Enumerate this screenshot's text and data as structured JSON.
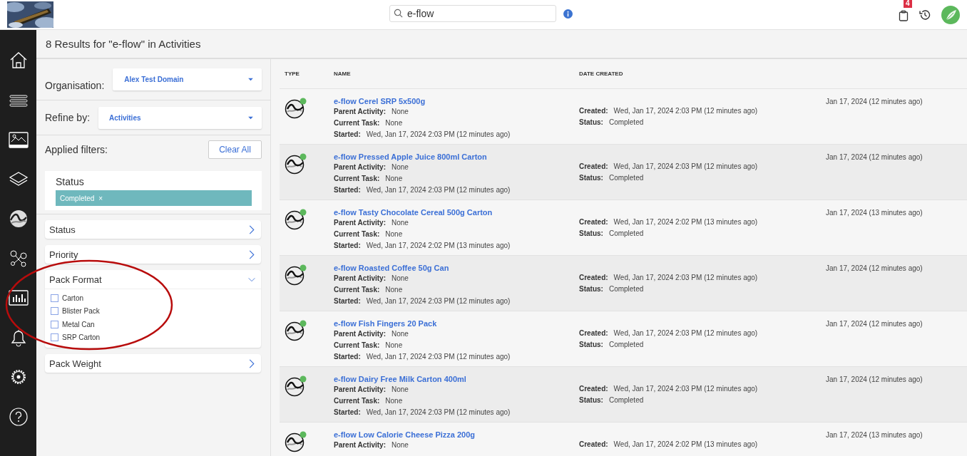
{
  "header": {
    "search": {
      "value": "e-flow"
    },
    "cart_badge": "4"
  },
  "nav": [
    {
      "kind": "home"
    },
    {
      "kind": "list"
    },
    {
      "kind": "gallery"
    },
    {
      "kind": "layers"
    },
    {
      "kind": "eflow"
    },
    {
      "kind": "network"
    },
    {
      "kind": "chart"
    },
    {
      "kind": "bell"
    },
    {
      "kind": "gear"
    },
    {
      "kind": "help"
    }
  ],
  "title": "8 Results for \"e-flow\" in Activities",
  "filters": {
    "organisation": {
      "label": "Organisation:",
      "value": "Alex Test Domain"
    },
    "refine": {
      "label": "Refine by:",
      "value": "Activities"
    },
    "applied": {
      "label": "Applied filters:",
      "clear": "Clear All",
      "groups": [
        {
          "title": "Status",
          "chips": [
            {
              "label": "Completed",
              "remove": "×"
            }
          ]
        }
      ]
    },
    "accordions": [
      {
        "title": "Status",
        "expanded": false
      },
      {
        "title": "Priority",
        "expanded": false
      },
      {
        "title": "Pack Format",
        "expanded": true,
        "options": [
          {
            "label": "Carton",
            "checked": false
          },
          {
            "label": "Blister Pack",
            "checked": false
          },
          {
            "label": "Metal Can",
            "checked": false
          },
          {
            "label": "SRP Carton",
            "checked": false
          }
        ]
      },
      {
        "title": "Pack Weight",
        "expanded": false
      }
    ]
  },
  "table": {
    "columns": [
      "TYPE",
      "NAME",
      "DATE CREATED"
    ],
    "rows": [
      {
        "name": "e-flow Cerel SRP 5x500g",
        "left": [
          {
            "label": "Parent Activity:",
            "value": "None"
          },
          {
            "label": "Current Task:",
            "value": "None"
          },
          {
            "label": "Started:",
            "value": "Wed, Jan 17, 2024 2:03 PM (12 minutes ago)"
          }
        ],
        "right": [
          {
            "label": "Created:",
            "value": "Wed, Jan 17, 2024 2:03 PM (12 minutes ago)"
          },
          {
            "label": "Status:",
            "value": "Completed"
          }
        ],
        "date": "Jan 17, 2024 (12 minutes ago)"
      },
      {
        "name": "e-flow Pressed Apple Juice 800ml Carton",
        "left": [
          {
            "label": "Parent Activity:",
            "value": "None"
          },
          {
            "label": "Current Task:",
            "value": "None"
          },
          {
            "label": "Started:",
            "value": "Wed, Jan 17, 2024 2:03 PM (12 minutes ago)"
          }
        ],
        "right": [
          {
            "label": "Created:",
            "value": "Wed, Jan 17, 2024 2:03 PM (12 minutes ago)"
          },
          {
            "label": "Status:",
            "value": "Completed"
          }
        ],
        "date": "Jan 17, 2024 (12 minutes ago)"
      },
      {
        "name": "e-flow Tasty Chocolate Cereal 500g Carton",
        "left": [
          {
            "label": "Parent Activity:",
            "value": "None"
          },
          {
            "label": "Current Task:",
            "value": "None"
          },
          {
            "label": "Started:",
            "value": "Wed, Jan 17, 2024 2:02 PM (13 minutes ago)"
          }
        ],
        "right": [
          {
            "label": "Created:",
            "value": "Wed, Jan 17, 2024 2:02 PM (13 minutes ago)"
          },
          {
            "label": "Status:",
            "value": "Completed"
          }
        ],
        "date": "Jan 17, 2024 (13 minutes ago)"
      },
      {
        "name": "e-flow Roasted Coffee 50g Can",
        "left": [
          {
            "label": "Parent Activity:",
            "value": "None"
          },
          {
            "label": "Current Task:",
            "value": "None"
          },
          {
            "label": "Started:",
            "value": "Wed, Jan 17, 2024 2:03 PM (12 minutes ago)"
          }
        ],
        "right": [
          {
            "label": "Created:",
            "value": "Wed, Jan 17, 2024 2:03 PM (12 minutes ago)"
          },
          {
            "label": "Status:",
            "value": "Completed"
          }
        ],
        "date": "Jan 17, 2024 (12 minutes ago)"
      },
      {
        "name": "e-flow Fish Fingers 20 Pack",
        "left": [
          {
            "label": "Parent Activity:",
            "value": "None"
          },
          {
            "label": "Current Task:",
            "value": "None"
          },
          {
            "label": "Started:",
            "value": "Wed, Jan 17, 2024 2:03 PM (12 minutes ago)"
          }
        ],
        "right": [
          {
            "label": "Created:",
            "value": "Wed, Jan 17, 2024 2:03 PM (12 minutes ago)"
          },
          {
            "label": "Status:",
            "value": "Completed"
          }
        ],
        "date": "Jan 17, 2024 (12 minutes ago)"
      },
      {
        "name": "e-flow Dairy Free Milk Carton 400ml",
        "left": [
          {
            "label": "Parent Activity:",
            "value": "None"
          },
          {
            "label": "Current Task:",
            "value": "None"
          },
          {
            "label": "Started:",
            "value": "Wed, Jan 17, 2024 2:03 PM (12 minutes ago)"
          }
        ],
        "right": [
          {
            "label": "Created:",
            "value": "Wed, Jan 17, 2024 2:03 PM (12 minutes ago)"
          },
          {
            "label": "Status:",
            "value": "Completed"
          }
        ],
        "date": "Jan 17, 2024 (12 minutes ago)"
      },
      {
        "name": "e-flow Low Calorie Cheese Pizza 200g",
        "left": [
          {
            "label": "Parent Activity:",
            "value": "None"
          }
        ],
        "right": [
          {
            "label": "Created:",
            "value": "Wed, Jan 17, 2024 2:02 PM (13 minutes ago)"
          }
        ],
        "date": "Jan 17, 2024 (13 minutes ago)"
      }
    ]
  }
}
